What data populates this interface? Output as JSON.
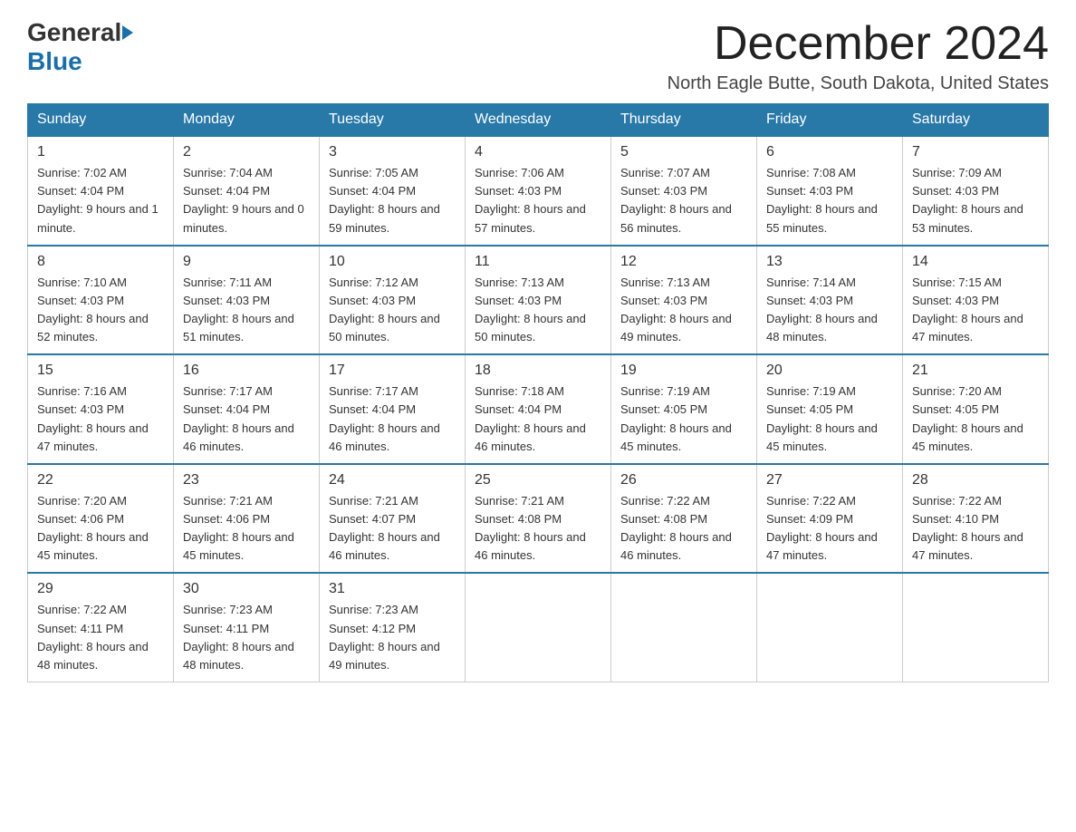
{
  "logo": {
    "general": "General",
    "blue": "Blue"
  },
  "title": "December 2024",
  "location": "North Eagle Butte, South Dakota, United States",
  "days_of_week": [
    "Sunday",
    "Monday",
    "Tuesday",
    "Wednesday",
    "Thursday",
    "Friday",
    "Saturday"
  ],
  "weeks": [
    [
      {
        "day": "1",
        "sunrise": "7:02 AM",
        "sunset": "4:04 PM",
        "daylight": "9 hours and 1 minute."
      },
      {
        "day": "2",
        "sunrise": "7:04 AM",
        "sunset": "4:04 PM",
        "daylight": "9 hours and 0 minutes."
      },
      {
        "day": "3",
        "sunrise": "7:05 AM",
        "sunset": "4:04 PM",
        "daylight": "8 hours and 59 minutes."
      },
      {
        "day": "4",
        "sunrise": "7:06 AM",
        "sunset": "4:03 PM",
        "daylight": "8 hours and 57 minutes."
      },
      {
        "day": "5",
        "sunrise": "7:07 AM",
        "sunset": "4:03 PM",
        "daylight": "8 hours and 56 minutes."
      },
      {
        "day": "6",
        "sunrise": "7:08 AM",
        "sunset": "4:03 PM",
        "daylight": "8 hours and 55 minutes."
      },
      {
        "day": "7",
        "sunrise": "7:09 AM",
        "sunset": "4:03 PM",
        "daylight": "8 hours and 53 minutes."
      }
    ],
    [
      {
        "day": "8",
        "sunrise": "7:10 AM",
        "sunset": "4:03 PM",
        "daylight": "8 hours and 52 minutes."
      },
      {
        "day": "9",
        "sunrise": "7:11 AM",
        "sunset": "4:03 PM",
        "daylight": "8 hours and 51 minutes."
      },
      {
        "day": "10",
        "sunrise": "7:12 AM",
        "sunset": "4:03 PM",
        "daylight": "8 hours and 50 minutes."
      },
      {
        "day": "11",
        "sunrise": "7:13 AM",
        "sunset": "4:03 PM",
        "daylight": "8 hours and 50 minutes."
      },
      {
        "day": "12",
        "sunrise": "7:13 AM",
        "sunset": "4:03 PM",
        "daylight": "8 hours and 49 minutes."
      },
      {
        "day": "13",
        "sunrise": "7:14 AM",
        "sunset": "4:03 PM",
        "daylight": "8 hours and 48 minutes."
      },
      {
        "day": "14",
        "sunrise": "7:15 AM",
        "sunset": "4:03 PM",
        "daylight": "8 hours and 47 minutes."
      }
    ],
    [
      {
        "day": "15",
        "sunrise": "7:16 AM",
        "sunset": "4:03 PM",
        "daylight": "8 hours and 47 minutes."
      },
      {
        "day": "16",
        "sunrise": "7:17 AM",
        "sunset": "4:04 PM",
        "daylight": "8 hours and 46 minutes."
      },
      {
        "day": "17",
        "sunrise": "7:17 AM",
        "sunset": "4:04 PM",
        "daylight": "8 hours and 46 minutes."
      },
      {
        "day": "18",
        "sunrise": "7:18 AM",
        "sunset": "4:04 PM",
        "daylight": "8 hours and 46 minutes."
      },
      {
        "day": "19",
        "sunrise": "7:19 AM",
        "sunset": "4:05 PM",
        "daylight": "8 hours and 45 minutes."
      },
      {
        "day": "20",
        "sunrise": "7:19 AM",
        "sunset": "4:05 PM",
        "daylight": "8 hours and 45 minutes."
      },
      {
        "day": "21",
        "sunrise": "7:20 AM",
        "sunset": "4:05 PM",
        "daylight": "8 hours and 45 minutes."
      }
    ],
    [
      {
        "day": "22",
        "sunrise": "7:20 AM",
        "sunset": "4:06 PM",
        "daylight": "8 hours and 45 minutes."
      },
      {
        "day": "23",
        "sunrise": "7:21 AM",
        "sunset": "4:06 PM",
        "daylight": "8 hours and 45 minutes."
      },
      {
        "day": "24",
        "sunrise": "7:21 AM",
        "sunset": "4:07 PM",
        "daylight": "8 hours and 46 minutes."
      },
      {
        "day": "25",
        "sunrise": "7:21 AM",
        "sunset": "4:08 PM",
        "daylight": "8 hours and 46 minutes."
      },
      {
        "day": "26",
        "sunrise": "7:22 AM",
        "sunset": "4:08 PM",
        "daylight": "8 hours and 46 minutes."
      },
      {
        "day": "27",
        "sunrise": "7:22 AM",
        "sunset": "4:09 PM",
        "daylight": "8 hours and 47 minutes."
      },
      {
        "day": "28",
        "sunrise": "7:22 AM",
        "sunset": "4:10 PM",
        "daylight": "8 hours and 47 minutes."
      }
    ],
    [
      {
        "day": "29",
        "sunrise": "7:22 AM",
        "sunset": "4:11 PM",
        "daylight": "8 hours and 48 minutes."
      },
      {
        "day": "30",
        "sunrise": "7:23 AM",
        "sunset": "4:11 PM",
        "daylight": "8 hours and 48 minutes."
      },
      {
        "day": "31",
        "sunrise": "7:23 AM",
        "sunset": "4:12 PM",
        "daylight": "8 hours and 49 minutes."
      },
      null,
      null,
      null,
      null
    ]
  ],
  "labels": {
    "sunrise": "Sunrise:",
    "sunset": "Sunset:",
    "daylight": "Daylight:"
  }
}
